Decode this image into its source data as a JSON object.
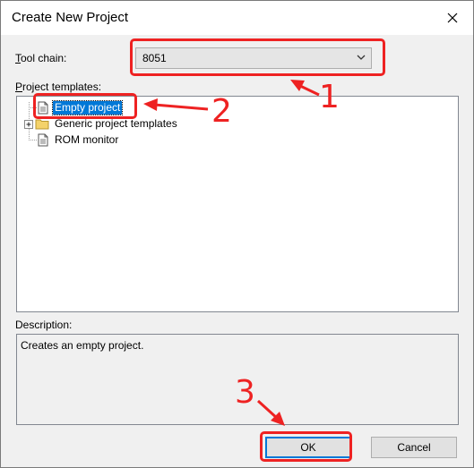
{
  "dialog": {
    "title": "Create New Project",
    "close_icon": "close-x-icon"
  },
  "toolchain": {
    "label": "Tool chain:",
    "value": "8051",
    "arrow_icon": "chevron-down-icon"
  },
  "templates": {
    "label": "Project templates:",
    "items": [
      {
        "label": "Empty project",
        "icon": "document-icon",
        "selected": true
      },
      {
        "label": "Generic project templates",
        "icon": "folder-icon",
        "expander": "plus-expander-icon"
      },
      {
        "label": "ROM monitor",
        "icon": "document-icon"
      }
    ]
  },
  "description": {
    "label": "Description:",
    "text": "Creates an empty project."
  },
  "buttons": {
    "ok": "OK",
    "cancel": "Cancel"
  },
  "annotations": {
    "color": "#ee2222",
    "steps": [
      "1",
      "2",
      "3"
    ]
  }
}
